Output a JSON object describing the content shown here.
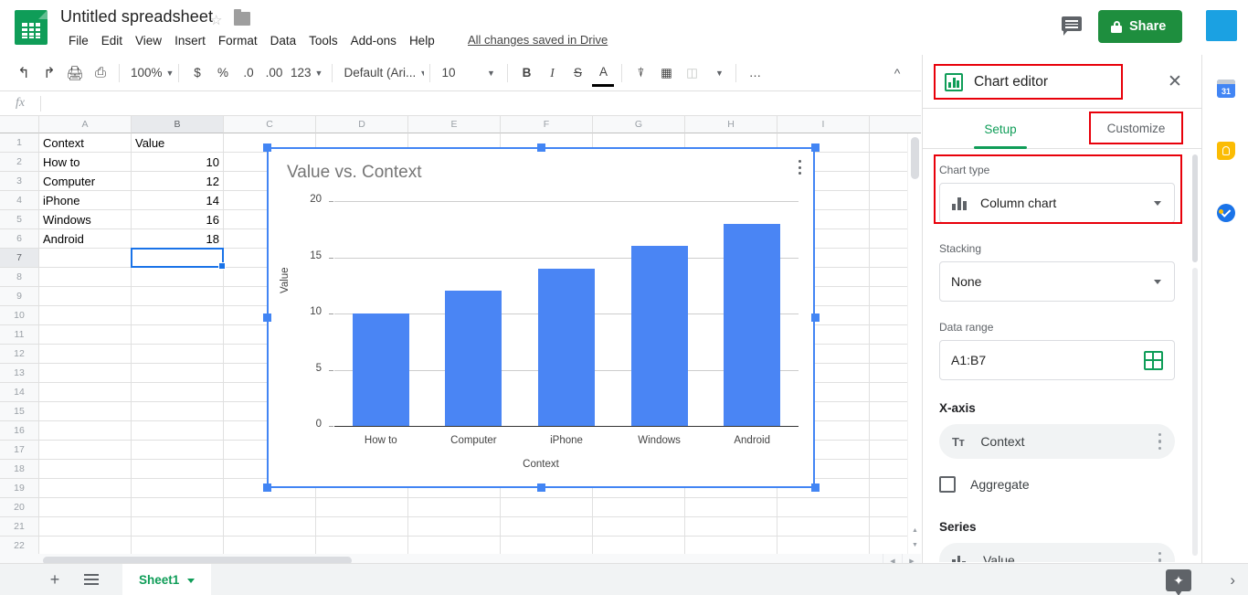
{
  "app": {
    "doc_title": "Untitled spreadsheet",
    "save_status": "All changes saved in Drive",
    "share_label": "Share",
    "logo_name": "google-sheets-logo"
  },
  "menu": {
    "items": [
      "File",
      "Edit",
      "View",
      "Insert",
      "Format",
      "Data",
      "Tools",
      "Add-ons",
      "Help"
    ]
  },
  "toolbar": {
    "zoom": "100%",
    "percent": "%",
    "currency": "$",
    "dec_less": ".0",
    "dec_more": ".00",
    "number_format": "123",
    "font": "Default (Ari...",
    "font_size": "10",
    "bold": "B",
    "italic": "I",
    "strikethrough": "S",
    "text_color": "A",
    "more": "…"
  },
  "formula_bar": {
    "fx": "fx",
    "value": "",
    "placeholder": ""
  },
  "grid": {
    "columns": [
      "A",
      "B",
      "C",
      "D",
      "E",
      "F",
      "G",
      "H",
      "I"
    ],
    "active_column": "B",
    "rows": [
      "1",
      "2",
      "3",
      "4",
      "5",
      "6",
      "7",
      "8",
      "9",
      "10",
      "11",
      "12",
      "13",
      "14",
      "15",
      "16",
      "17",
      "18",
      "19",
      "20",
      "21",
      "22"
    ],
    "active_row": "7",
    "selected_cell": "B7",
    "data": [
      {
        "row": 1,
        "a": "Context",
        "b": ""
      },
      {
        "row": 2,
        "a": "How to",
        "b": "10"
      },
      {
        "row": 3,
        "a": "Computer",
        "b": "12"
      },
      {
        "row": 4,
        "a": "iPhone",
        "b": "14"
      },
      {
        "row": 5,
        "a": "Windows",
        "b": "16"
      },
      {
        "row": 6,
        "a": "Android",
        "b": "18"
      }
    ],
    "header_b": "Value"
  },
  "chart_data": {
    "type": "bar",
    "title": "Value vs. Context",
    "xlabel": "Context",
    "ylabel": "Value",
    "categories": [
      "How to",
      "Computer",
      "iPhone",
      "Windows",
      "Android"
    ],
    "values": [
      10,
      12,
      14,
      16,
      18
    ],
    "yticks": [
      "0",
      "5",
      "10",
      "15",
      "20"
    ],
    "ylim": [
      0,
      20
    ],
    "grid": true,
    "legend": "none",
    "series_color": "#4a85f4"
  },
  "chart_editor": {
    "title": "Chart editor",
    "close_label": "✕",
    "tabs": {
      "setup": "Setup",
      "customize": "Customize"
    },
    "chart_type": {
      "label": "Chart type",
      "value": "Column chart"
    },
    "stacking": {
      "label": "Stacking",
      "value": "None"
    },
    "data_range": {
      "label": "Data range",
      "value": "A1:B7"
    },
    "x_axis": {
      "label": "X-axis",
      "value": "Context",
      "type_glyph": "Tᴛ"
    },
    "aggregate": {
      "label": "Aggregate",
      "checked": false
    },
    "series": {
      "label": "Series",
      "value": "Value"
    },
    "highlight_color": "#e8000a"
  },
  "bottom": {
    "add_sheet": "+",
    "all_sheets": "all-sheets-icon",
    "sheet_name": "Sheet1",
    "explore": "explore-icon",
    "expand": "›"
  },
  "side_rail": {
    "calendar": "31",
    "keep": "keep-icon",
    "tasks": "tasks-icon"
  }
}
